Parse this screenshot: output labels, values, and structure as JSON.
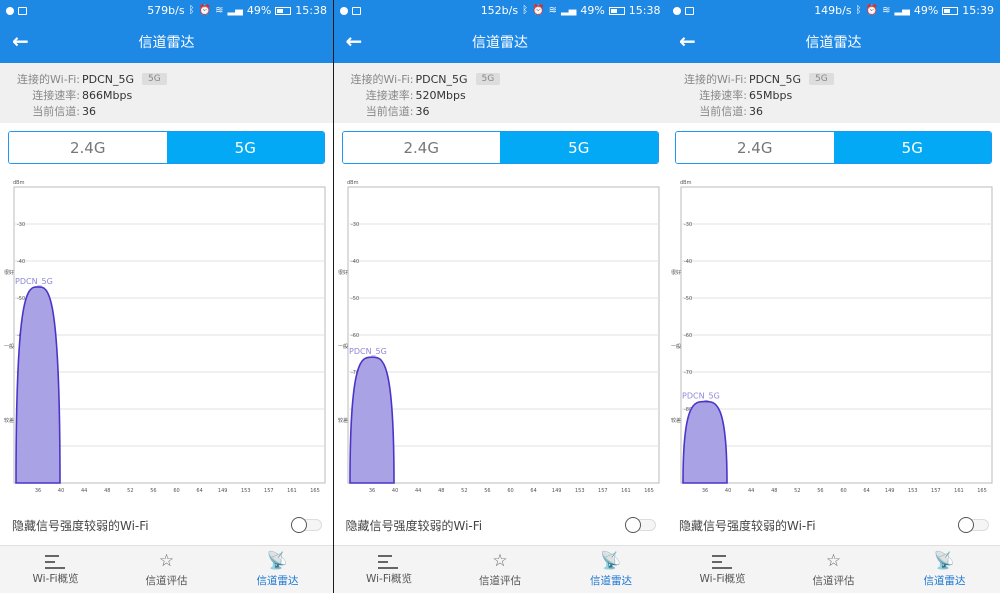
{
  "common": {
    "title": "信道雷达",
    "back_icon": "arrow-left-icon",
    "wifi_label": "连接的Wi-Fi:",
    "speed_label": "连接速率:",
    "channel_label": "当前信道:",
    "ssid": "PDCN_5G",
    "band_tag": "5G",
    "channel": "36",
    "seg_24": "2.4G",
    "seg_5": "5G",
    "hide_weak": "隐藏信号强度较弱的Wi-Fi",
    "tabs": [
      "Wi-Fi概览",
      "信道评估",
      "信道雷达"
    ],
    "accent": "#1e88e5",
    "segment_active": "#03a9f4",
    "curve_fill": "#a9a3e6",
    "curve_stroke": "#4a35c8",
    "battery": "49%"
  },
  "phones": [
    {
      "rate": "579b/s",
      "time": "15:38",
      "link_speed": "866Mbps"
    },
    {
      "rate": "152b/s",
      "time": "15:38",
      "link_speed": "520Mbps"
    },
    {
      "rate": "149b/s",
      "time": "15:39",
      "link_speed": "65Mbps"
    }
  ],
  "chart_data": [
    {
      "type": "area",
      "ylabel": "dBm",
      "y_ticks": [
        -30,
        -40,
        -50,
        -60,
        -70,
        -80,
        -90
      ],
      "y_quality_labels": [
        "很好",
        "一般",
        "较差"
      ],
      "x_ticks": [
        36,
        40,
        44,
        48,
        52,
        56,
        60,
        64,
        149,
        153,
        157,
        161,
        165
      ],
      "series": [
        {
          "name": "PDCN_5G",
          "channel": 36,
          "peak_dbm": -47
        }
      ]
    },
    {
      "type": "area",
      "ylabel": "dBm",
      "y_ticks": [
        -30,
        -40,
        -50,
        -60,
        -70,
        -80,
        -90
      ],
      "y_quality_labels": [
        "很好",
        "一般",
        "较差"
      ],
      "x_ticks": [
        36,
        40,
        44,
        48,
        52,
        56,
        60,
        64,
        149,
        153,
        157,
        161,
        165
      ],
      "series": [
        {
          "name": "PDCN_5G",
          "channel": 36,
          "peak_dbm": -66
        }
      ]
    },
    {
      "type": "area",
      "ylabel": "dBm",
      "y_ticks": [
        -30,
        -40,
        -50,
        -60,
        -70,
        -80,
        -90
      ],
      "y_quality_labels": [
        "很好",
        "一般",
        "较差"
      ],
      "x_ticks": [
        36,
        40,
        44,
        48,
        52,
        56,
        60,
        64,
        149,
        153,
        157,
        161,
        165
      ],
      "series": [
        {
          "name": "PDCN_5G",
          "channel": 36,
          "peak_dbm": -78
        }
      ]
    }
  ]
}
